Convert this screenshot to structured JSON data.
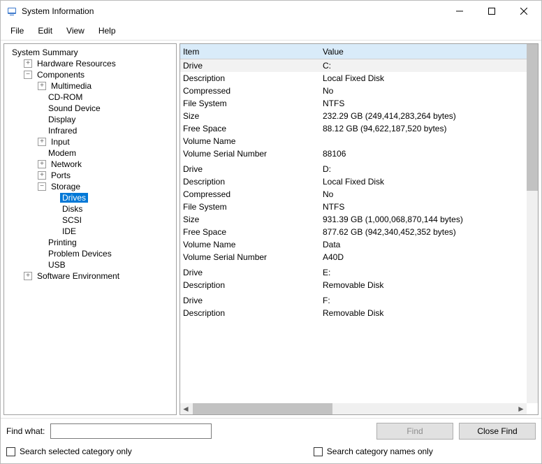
{
  "window": {
    "title": "System Information"
  },
  "menubar": [
    "File",
    "Edit",
    "View",
    "Help"
  ],
  "tree": {
    "root": "System Summary",
    "hw": "Hardware Resources",
    "components": "Components",
    "mm": "Multimedia",
    "cdrom": "CD-ROM",
    "sound": "Sound Device",
    "display": "Display",
    "infrared": "Infrared",
    "input": "Input",
    "modem": "Modem",
    "network": "Network",
    "ports": "Ports",
    "storage": "Storage",
    "drives": "Drives",
    "disks": "Disks",
    "scsi": "SCSI",
    "ide": "IDE",
    "printing": "Printing",
    "problem": "Problem Devices",
    "usb": "USB",
    "swenv": "Software Environment"
  },
  "columns": {
    "item": "Item",
    "value": "Value"
  },
  "rows": [
    {
      "item": "Drive",
      "value": "C:",
      "shade": true
    },
    {
      "item": "Description",
      "value": "Local Fixed Disk"
    },
    {
      "item": "Compressed",
      "value": "No"
    },
    {
      "item": "File System",
      "value": "NTFS"
    },
    {
      "item": "Size",
      "value": "232.29 GB (249,414,283,264 bytes)"
    },
    {
      "item": "Free Space",
      "value": "88.12 GB (94,622,187,520 bytes)"
    },
    {
      "item": "Volume Name",
      "value": ""
    },
    {
      "item": "Volume Serial Number",
      "value": "88106"
    },
    {
      "item": "",
      "value": ""
    },
    {
      "item": "Drive",
      "value": "D:"
    },
    {
      "item": "Description",
      "value": "Local Fixed Disk"
    },
    {
      "item": "Compressed",
      "value": "No"
    },
    {
      "item": "File System",
      "value": "NTFS"
    },
    {
      "item": "Size",
      "value": "931.39 GB (1,000,068,870,144 bytes)"
    },
    {
      "item": "Free Space",
      "value": "877.62 GB (942,340,452,352 bytes)"
    },
    {
      "item": "Volume Name",
      "value": "Data"
    },
    {
      "item": "Volume Serial Number",
      "value": "A40D"
    },
    {
      "item": "",
      "value": ""
    },
    {
      "item": "Drive",
      "value": "E:"
    },
    {
      "item": "Description",
      "value": "Removable Disk"
    },
    {
      "item": "",
      "value": ""
    },
    {
      "item": "Drive",
      "value": "F:"
    },
    {
      "item": "Description",
      "value": "Removable Disk"
    }
  ],
  "find": {
    "label": "Find what:",
    "find_btn": "Find",
    "close_btn": "Close Find",
    "chk1": "Search selected category only",
    "chk2": "Search category names only"
  }
}
